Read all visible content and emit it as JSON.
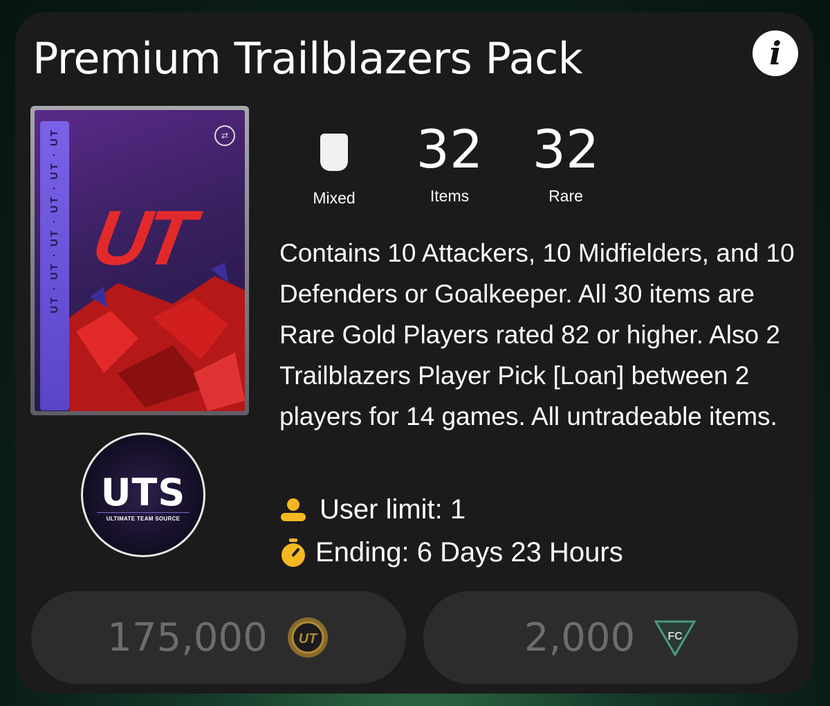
{
  "pack": {
    "title": "Premium Trailblazers Pack",
    "art_label": "UT",
    "stats": [
      {
        "value": "",
        "label": "Mixed",
        "icon": "shield-icon"
      },
      {
        "value": "32",
        "label": "Items"
      },
      {
        "value": "32",
        "label": "Rare"
      }
    ],
    "description": "Contains 10 Attackers, 10 Midfielders, and 10 Defenders or Goalkeeper. All 30 items are Rare Gold Players rated 82 or higher. Also 2 Trailblazers Player Pick [Loan] between 2 players for 14 games. All untradeable items.",
    "user_limit": "User limit: 1",
    "ending": "Ending: 6 Days 23 Hours"
  },
  "watermark": {
    "big": "UTS",
    "small": "ULTIMATE TEAM SOURCE"
  },
  "buttons": {
    "coins_price": "175,000",
    "points_price": "2,000"
  },
  "colors": {
    "accent": "#f5b820",
    "panel": "#1b1b1b",
    "button": "#2c2c2c"
  }
}
